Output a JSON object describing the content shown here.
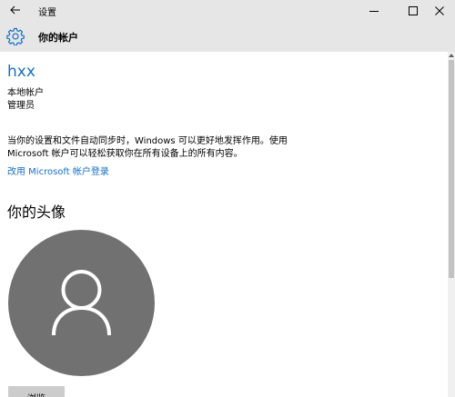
{
  "window": {
    "title": "设置",
    "back_icon": "back-arrow-icon",
    "controls": [
      "minimize-icon",
      "maximize-icon",
      "close-icon"
    ]
  },
  "header": {
    "icon": "gear-icon",
    "title": "你的帐户"
  },
  "account": {
    "username": "hxx",
    "type": "本地帐户",
    "role": "管理员"
  },
  "sync_notice": {
    "text": "当你的设置和文件自动同步时，Windows 可以更好地发挥作用。使用 Microsoft 帐户可以轻松获取你在所有设备上的所有内容。",
    "link_label": "改用 Microsoft 帐户登录"
  },
  "avatar_section": {
    "heading": "你的头像",
    "avatar_icon": "user-icon",
    "browse_label": "浏览"
  },
  "colors": {
    "accent": "#1a6ebd",
    "titlebar_bg": "#e6e6e6",
    "avatar_bg": "#717171",
    "button_bg": "#cccccc"
  }
}
